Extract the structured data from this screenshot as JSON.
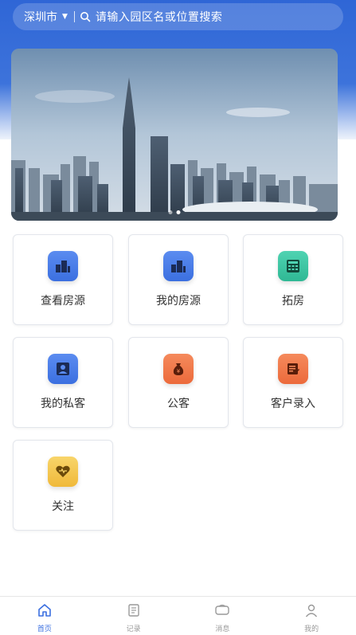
{
  "search": {
    "city": "深圳市",
    "placeholder": "请输入园区名或位置搜索"
  },
  "banner": {
    "slides": 2,
    "active_index": 1
  },
  "menu": [
    {
      "label": "查看房源",
      "icon": "buildings-icon",
      "color": "#3b6fe0"
    },
    {
      "label": "我的房源",
      "icon": "buildings-icon",
      "color": "#3b6fe0"
    },
    {
      "label": "拓房",
      "icon": "calculator-icon",
      "color": "#2fb894"
    },
    {
      "label": "我的私客",
      "icon": "person-icon",
      "color": "#3b6fe0"
    },
    {
      "label": "公客",
      "icon": "money-bag-icon",
      "color": "#ec6a3b"
    },
    {
      "label": "客户录入",
      "icon": "edit-note-icon",
      "color": "#ec6a3b"
    },
    {
      "label": "关注",
      "icon": "heart-icon",
      "color": "#f0b93a"
    }
  ],
  "tabbar": [
    {
      "label": "首页",
      "icon": "home-icon",
      "active": true
    },
    {
      "label": "记录",
      "icon": "record-icon",
      "active": false
    },
    {
      "label": "消息",
      "icon": "message-icon",
      "active": false
    },
    {
      "label": "我的",
      "icon": "user-icon",
      "active": false
    }
  ],
  "colors": {
    "primary": "#3b6fe0",
    "header": "#2f66d6"
  }
}
